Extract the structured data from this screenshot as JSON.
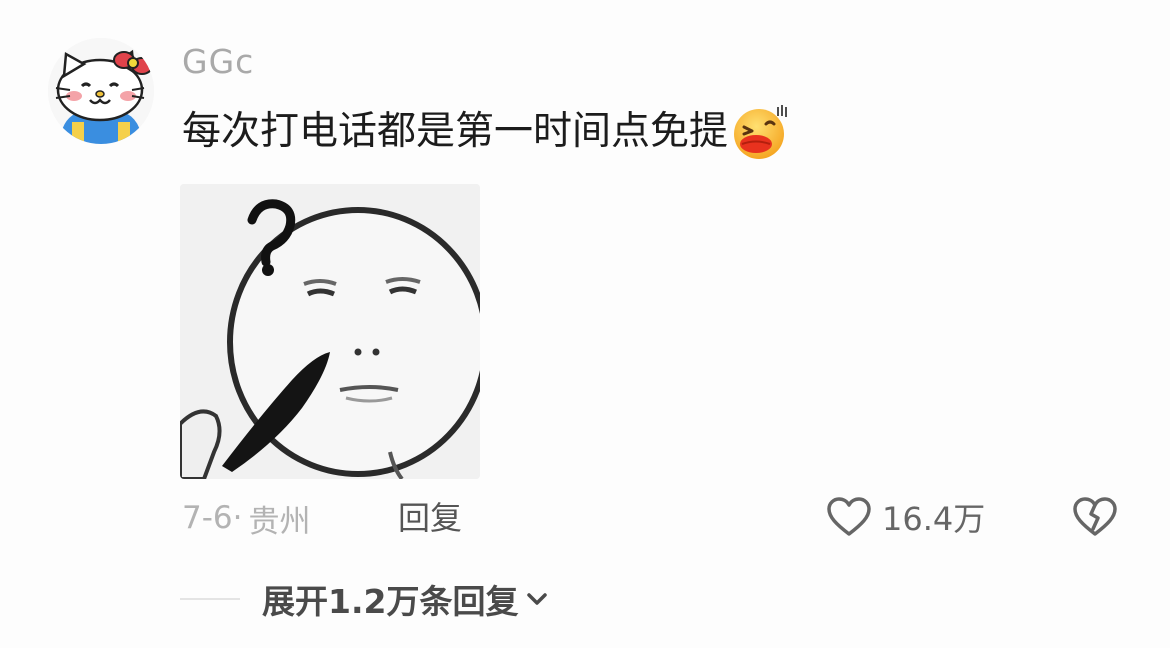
{
  "comment": {
    "username": "GGc",
    "text": "每次打电话都是第一时间点免提",
    "emoji_icon": "laughing-face-emoji",
    "sticker_icon": "confused-face-meme-sticker",
    "date": "7-6·",
    "location": "贵州",
    "reply_label": "回复",
    "like_count": "16.4万",
    "expand_label": "展开1.2万条回复"
  },
  "colors": {
    "username": "#a9a9a9",
    "text": "#1c1c1c",
    "meta": "#b3b3b3",
    "reply": "#555555",
    "like": "#666666"
  }
}
